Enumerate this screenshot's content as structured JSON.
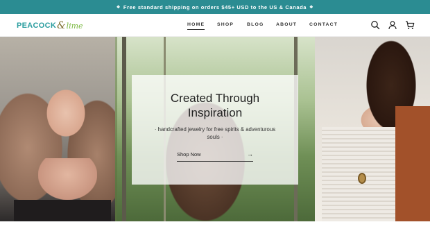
{
  "announcement": {
    "text": "Free standard shipping on orders $45+ USD to the US & Canada",
    "icon_left": "diamond-icon",
    "icon_right": "diamond-icon",
    "bg_color": "#2b8c92"
  },
  "header": {
    "logo": {
      "word1": "PEACOCK",
      "amp": "&",
      "word2": "lime"
    },
    "nav": [
      {
        "label": "HOME",
        "active": true
      },
      {
        "label": "SHOP"
      },
      {
        "label": "BLOG"
      },
      {
        "label": "ABOUT"
      },
      {
        "label": "CONTACT"
      }
    ],
    "icons": [
      "search-icon",
      "account-icon",
      "cart-icon"
    ]
  },
  "hero": {
    "title": "Created Through Inspiration",
    "subtitle": "· handcrafted jewelry for free spirits & adventurous souls ·",
    "cta_label": "Shop Now",
    "cta_icon": "arrow-right-icon"
  }
}
